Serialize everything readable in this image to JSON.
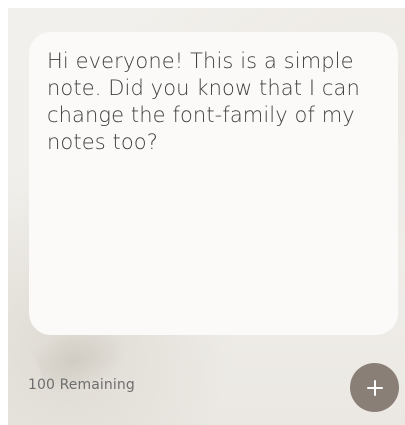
{
  "note": {
    "text": "Hi everyone! This is a simple note. Did you know that I can change the font-family of my notes too?"
  },
  "footer": {
    "remaining_label": "100 Remaining"
  },
  "add_button": {
    "icon": "plus-icon",
    "color": "#8a7f77"
  }
}
